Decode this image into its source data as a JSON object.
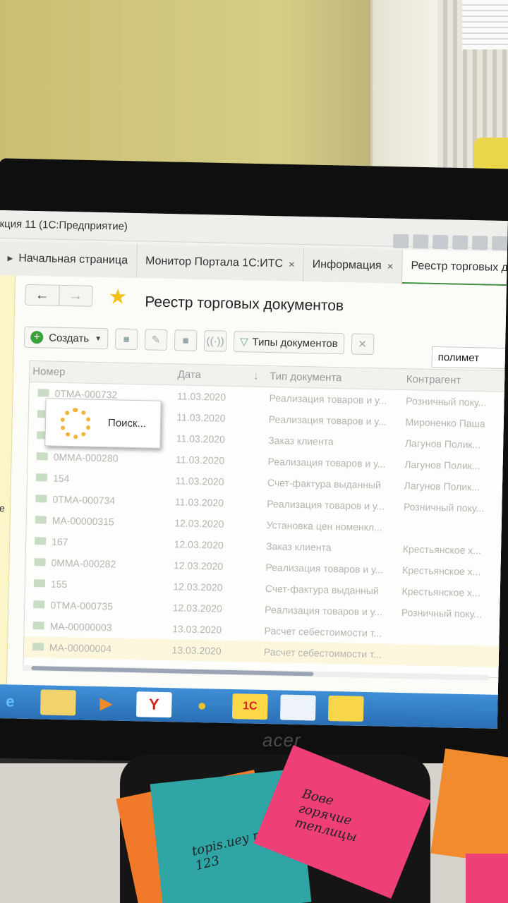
{
  "window": {
    "title": "кция 11  (1С:Предприятие)"
  },
  "tabs": [
    {
      "label": "Начальная страница",
      "closable": false
    },
    {
      "label": "Монитор Портала 1С:ИТС",
      "closable": true
    },
    {
      "label": "Информация",
      "closable": true
    },
    {
      "label": "Реестр торговых до",
      "closable": false
    }
  ],
  "close_glyph": "×",
  "leftbar": {
    "text": "ие"
  },
  "page": {
    "title": "Реестр торговых документов"
  },
  "toolbar": {
    "create_label": "Создать",
    "doc_types_label": "Типы документов",
    "search_value": "полимет"
  },
  "grid": {
    "columns": [
      "Номер",
      "Дата",
      "Тип документа",
      "Контрагент"
    ],
    "rows": [
      {
        "num": "0ТМА-000732",
        "date": "11.03.2020",
        "type": "Реализация товаров и у...",
        "ctr": "Розничный поку..."
      },
      {
        "num": "",
        "date": "11.03.2020",
        "type": "Реализация товаров и у...",
        "ctr": "Мироненко Паша"
      },
      {
        "num": "",
        "date": "11.03.2020",
        "type": "Заказ клиента",
        "ctr": "Лагунов Полик..."
      },
      {
        "num": "0ММА-000280",
        "date": "11.03.2020",
        "type": "Реализация товаров и у...",
        "ctr": "Лагунов Полик..."
      },
      {
        "num": "154",
        "date": "11.03.2020",
        "type": "Счет-фактура выданный",
        "ctr": "Лагунов Полик..."
      },
      {
        "num": "0ТМА-000734",
        "date": "11.03.2020",
        "type": "Реализация товаров и у...",
        "ctr": "Розничный поку..."
      },
      {
        "num": "МА-00000315",
        "date": "12.03.2020",
        "type": "Установка цен номенкл...",
        "ctr": ""
      },
      {
        "num": "167",
        "date": "12.03.2020",
        "type": "Заказ клиента",
        "ctr": "Крестьянское х..."
      },
      {
        "num": "0ММА-000282",
        "date": "12.03.2020",
        "type": "Реализация товаров и у...",
        "ctr": "Крестьянское х..."
      },
      {
        "num": "155",
        "date": "12.03.2020",
        "type": "Счет-фактура выданный",
        "ctr": "Крестьянское х..."
      },
      {
        "num": "0ТМА-000735",
        "date": "12.03.2020",
        "type": "Реализация товаров и у...",
        "ctr": "Розничный поку..."
      },
      {
        "num": "МА-00000003",
        "date": "13.03.2020",
        "type": "Расчет себестоимости т...",
        "ctr": ""
      },
      {
        "num": "МА-00000004",
        "date": "13.03.2020",
        "type": "Расчет себестоимости т...",
        "ctr": ""
      }
    ]
  },
  "popup": {
    "text": "Поиск..."
  },
  "taskbar": {
    "onec_label": "1С"
  },
  "monitor": {
    "brand": "acer"
  },
  "notes": {
    "pink_text": "Вове горячие теплицы",
    "teal_text": "topis.uey таке 123"
  },
  "colors": {
    "accent_green": "#3aa13a",
    "taskbar_blue": "#2a6fb5",
    "star": "#f1c21b"
  }
}
